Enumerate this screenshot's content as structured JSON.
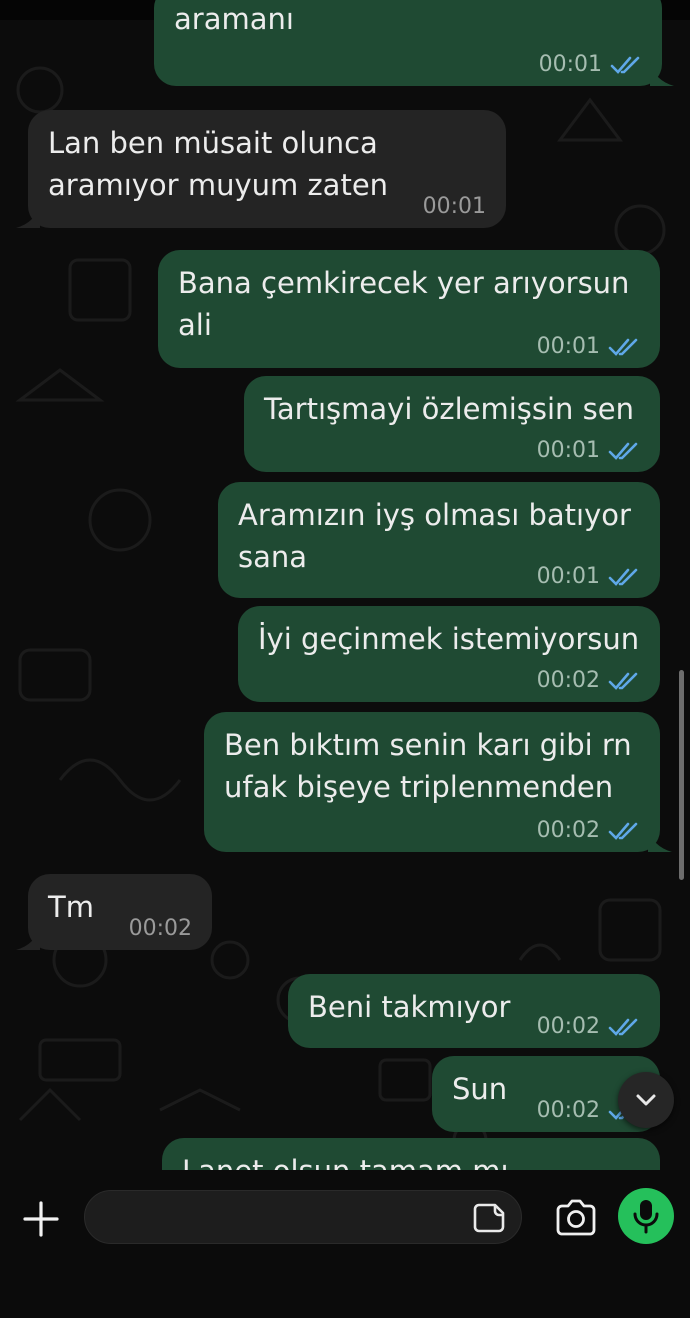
{
  "messages": [
    {
      "dir": "out",
      "text": "aramanı",
      "time": "00:01"
    },
    {
      "dir": "in",
      "text": "Lan ben müsait olunca\naramıyor muyum zaten",
      "time": "00:01"
    },
    {
      "dir": "out",
      "text": "Bana çemkirecek yer arıyorsun\nali",
      "time": "00:01"
    },
    {
      "dir": "out",
      "text": "Tartışmayi özlemişsin sen",
      "time": "00:01"
    },
    {
      "dir": "out",
      "text": "Aramızın iyş olması batıyor\nsana",
      "time": "00:01"
    },
    {
      "dir": "out",
      "text": "İyi geçinmek istemiyorsun",
      "time": "00:02"
    },
    {
      "dir": "out",
      "text": "Ben bıktım senin karı gibi rn\nufak bişeye triplenmenden",
      "time": "00:02"
    },
    {
      "dir": "in",
      "text": "Tm",
      "time": "00:02"
    },
    {
      "dir": "out",
      "text": "Beni takmıyor",
      "time": "00:02"
    },
    {
      "dir": "out",
      "text": "Sun",
      "time": "00:02"
    },
    {
      "dir": "out",
      "text": "Lanet olsun tamam mı",
      "time": ""
    }
  ],
  "colors": {
    "outgoing_bubble": "#1f4a33",
    "incoming_bubble": "#242424",
    "read_ticks": "#5fa8e8",
    "mic_button": "#25c05b",
    "background": "#0b0b0b"
  },
  "icons": {
    "attach": "plus-icon",
    "sticker": "sticker-icon",
    "camera": "camera-icon",
    "mic": "microphone-icon",
    "scroll_down": "chevron-down-icon",
    "read_receipt": "double-check-icon"
  },
  "composer": {
    "input_value": "",
    "input_placeholder": ""
  }
}
